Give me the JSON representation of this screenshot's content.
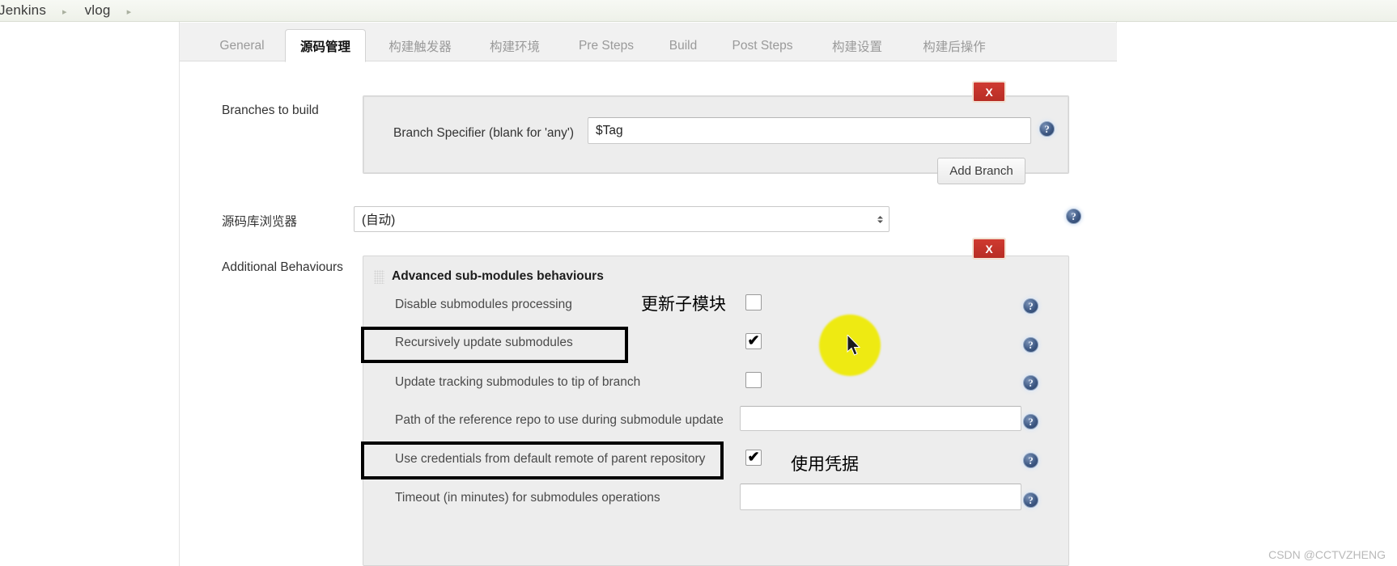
{
  "breadcrumb": {
    "items": [
      "Jenkins",
      "vlog"
    ],
    "separator": "▸"
  },
  "tabs": [
    {
      "label": "General",
      "active": false
    },
    {
      "label": "源码管理",
      "active": true
    },
    {
      "label": "构建触发器",
      "active": false
    },
    {
      "label": "构建环境",
      "active": false
    },
    {
      "label": "Pre Steps",
      "active": false
    },
    {
      "label": "Build",
      "active": false
    },
    {
      "label": "Post Steps",
      "active": false
    },
    {
      "label": "构建设置",
      "active": false
    },
    {
      "label": "构建后操作",
      "active": false
    }
  ],
  "branches_section": {
    "label": "Branches to build",
    "delete_label": "X",
    "specifier_label": "Branch Specifier (blank for 'any')",
    "specifier_value": "$Tag",
    "add_branch_label": "Add Branch",
    "help_label": "?"
  },
  "repo_browser": {
    "label": "源码库浏览器",
    "selected": "(自动)",
    "help_label": "?"
  },
  "additional_behaviours": {
    "label": "Additional Behaviours",
    "delete_label": "X",
    "panel_title": "Advanced sub-modules behaviours",
    "options": [
      {
        "label": "Disable submodules processing",
        "type": "checkbox",
        "checked": false,
        "highlighted": false
      },
      {
        "label": "Recursively update submodules",
        "type": "checkbox",
        "checked": true,
        "highlighted": true
      },
      {
        "label": "Update tracking submodules to tip of branch",
        "type": "checkbox",
        "checked": false,
        "highlighted": false
      },
      {
        "label": "Path of the reference repo to use during submodule update",
        "type": "text",
        "value": "",
        "highlighted": false
      },
      {
        "label": "Use credentials from default remote of parent repository",
        "type": "checkbox",
        "checked": true,
        "highlighted": true
      },
      {
        "label": "Timeout (in minutes) for submodules operations",
        "type": "number",
        "value": "",
        "highlighted": false
      }
    ],
    "help_label": "?"
  },
  "annotations": [
    {
      "text": "更新子模块"
    },
    {
      "text": "使用凭据"
    }
  ],
  "watermark": "CSDN @CCTVZHENG",
  "colors": {
    "delete_red": "#bf3328",
    "highlight_yellow": "#eeea12",
    "annotation_black": "#000000",
    "tab_active_text": "#111111",
    "tab_inactive_text": "#9a9a9a"
  }
}
